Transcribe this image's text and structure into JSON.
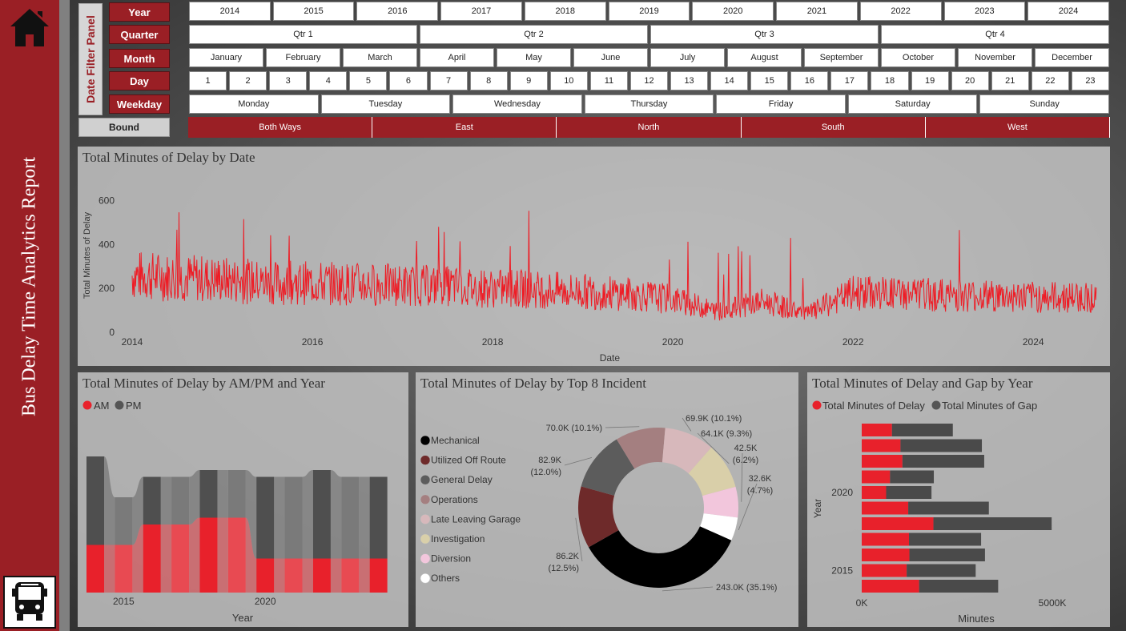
{
  "report_title": "Bus Delay Time Analytics Report",
  "filter_panel": {
    "title": "Date Filter Panel",
    "labels": {
      "year": "Year",
      "quarter": "Quarter",
      "month": "Month",
      "day": "Day",
      "weekday": "Weekday",
      "bound": "Bound"
    },
    "years": [
      "2014",
      "2015",
      "2016",
      "2017",
      "2018",
      "2019",
      "2020",
      "2021",
      "2022",
      "2023",
      "2024"
    ],
    "quarters": [
      "Qtr 1",
      "Qtr 2",
      "Qtr 3",
      "Qtr 4"
    ],
    "months": [
      "January",
      "February",
      "March",
      "April",
      "May",
      "June",
      "July",
      "August",
      "September",
      "October",
      "November",
      "December"
    ],
    "days": [
      "1",
      "2",
      "3",
      "4",
      "5",
      "6",
      "7",
      "8",
      "9",
      "10",
      "11",
      "12",
      "13",
      "14",
      "15",
      "16",
      "17",
      "18",
      "19",
      "20",
      "21",
      "22",
      "23"
    ],
    "weekdays": [
      "Monday",
      "Tuesday",
      "Wednesday",
      "Thursday",
      "Friday",
      "Saturday",
      "Sunday"
    ],
    "bounds": [
      "Both Ways",
      "East",
      "North",
      "South",
      "West"
    ]
  },
  "colors": {
    "accent": "#9a1f25",
    "line": "#ee1c25",
    "am": "#e8212b",
    "pm": "#555555"
  },
  "chart_data": [
    {
      "type": "line",
      "title": "Total Minutes of Delay by Date",
      "xlabel": "Date",
      "ylabel": "Total Minutes of Delay",
      "ylim": [
        0,
        700
      ],
      "yticks": [
        "0",
        "200",
        "400",
        "600"
      ],
      "xticks": [
        "2014",
        "2016",
        "2018",
        "2020",
        "2022",
        "2024"
      ],
      "series": [
        {
          "x": [
            2014.0,
            2014.5,
            2015.0,
            2015.5,
            2016.0,
            2016.5,
            2017.0,
            2017.5,
            2018.0,
            2018.5,
            2019.0,
            2019.5,
            2020.0,
            2020.5,
            2021.0,
            2021.5,
            2022.0,
            2022.5,
            2023.0,
            2023.5,
            2024.0,
            2024.5
          ],
          "values": [
            260,
            250,
            240,
            225,
            225,
            220,
            215,
            210,
            200,
            195,
            185,
            175,
            150,
            95,
            140,
            85,
            180,
            175,
            170,
            165,
            160,
            160
          ]
        }
      ]
    },
    {
      "type": "area",
      "title": "Total Minutes of Delay by AM/PM and Year",
      "xlabel": "Year",
      "xticks": [
        "2015",
        "2020"
      ],
      "categories": [
        "2014",
        "2015",
        "2016",
        "2017",
        "2018",
        "2019",
        "2020",
        "2021",
        "2022",
        "2023",
        "2024"
      ],
      "series": [
        {
          "name": "AM",
          "values": [
            0.35,
            0.35,
            0.5,
            0.5,
            0.55,
            0.55,
            0.25,
            0.25,
            0.25,
            0.25,
            0.25
          ]
        },
        {
          "name": "PM",
          "values": [
            0.65,
            0.35,
            0.35,
            0.35,
            0.35,
            0.35,
            0.6,
            0.6,
            0.65,
            0.6,
            0.6
          ]
        }
      ]
    },
    {
      "type": "pie",
      "title": "Total Minutes of Delay by Top 8 Incident",
      "series": [
        {
          "name": "Mechanical",
          "label": "243.0K (35.1%)",
          "value": 35.1,
          "color": "#000000"
        },
        {
          "name": "Utilized Off Route",
          "label": "86.2K (12.5%)",
          "value": 12.5,
          "color": "#6e2a2a"
        },
        {
          "name": "General Delay",
          "label": "82.9K (12.0%)",
          "value": 12.0,
          "color": "#5c5c5c"
        },
        {
          "name": "Operations",
          "label": "70.0K (10.1%)",
          "value": 10.1,
          "color": "#a47f80"
        },
        {
          "name": "Late Leaving Garage",
          "label": "69.9K (10.1%)",
          "value": 10.1,
          "color": "#d7b8bb"
        },
        {
          "name": "Investigation",
          "label": "64.1K (9.3%)",
          "value": 9.3,
          "color": "#d9cfa9"
        },
        {
          "name": "Diversion",
          "label": "42.5K (6.2%)",
          "value": 6.2,
          "color": "#f2c6dc"
        },
        {
          "name": "Others",
          "label": "32.6K (4.7%)",
          "value": 4.7,
          "color": "#ffffff"
        }
      ]
    },
    {
      "type": "bar",
      "title": "Total Minutes of Delay and Gap by Year",
      "xlabel": "Minutes",
      "ylabel": "Year",
      "xticks": [
        "0K",
        "5000K"
      ],
      "yticks": [
        "2020",
        "2015"
      ],
      "xlim": [
        0,
        5000
      ],
      "categories": [
        "2024",
        "2023",
        "2022",
        "2021",
        "2020",
        "2019",
        "2018",
        "2017",
        "2016",
        "2015",
        "2014"
      ],
      "series": [
        {
          "name": "Total Minutes of Delay",
          "values": [
            780,
            1000,
            1050,
            730,
            630,
            1200,
            1850,
            1220,
            1230,
            1160,
            1480
          ]
        },
        {
          "name": "Total Minutes of Gap",
          "values": [
            2350,
            3100,
            3160,
            1860,
            1800,
            3280,
            4900,
            3080,
            3180,
            2940,
            3520
          ]
        }
      ]
    }
  ]
}
